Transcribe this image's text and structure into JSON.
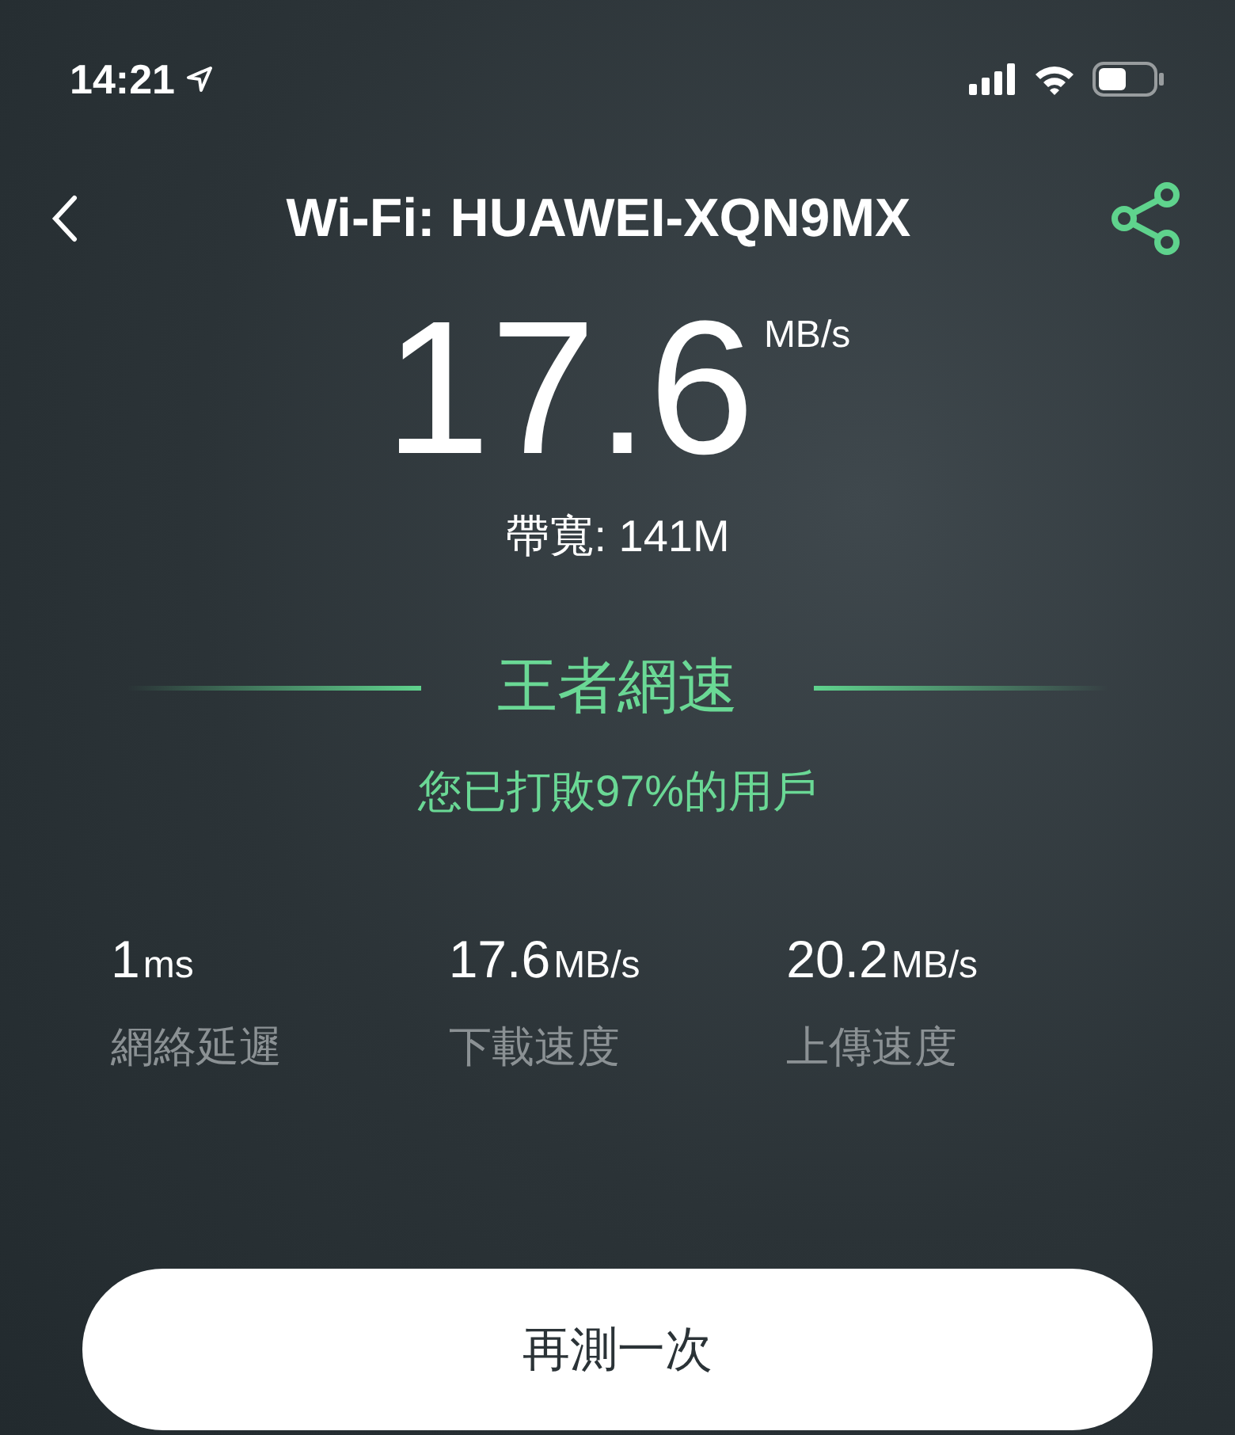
{
  "status_bar": {
    "time": "14:21"
  },
  "header": {
    "title": "Wi-Fi: HUAWEI-XQN9MX"
  },
  "result": {
    "speed": "17.6",
    "unit": "MB/s",
    "bandwidth": "帶寬: 141M",
    "rank": "王者網速",
    "beaten": "您已打敗97%的用戶"
  },
  "stats": [
    {
      "value": "1",
      "unit": "ms",
      "label": "網絡延遲"
    },
    {
      "value": "17.6",
      "unit": "MB/s",
      "label": "下載速度"
    },
    {
      "value": "20.2",
      "unit": "MB/s",
      "label": "上傳速度"
    }
  ],
  "retest_button": "再測一次"
}
